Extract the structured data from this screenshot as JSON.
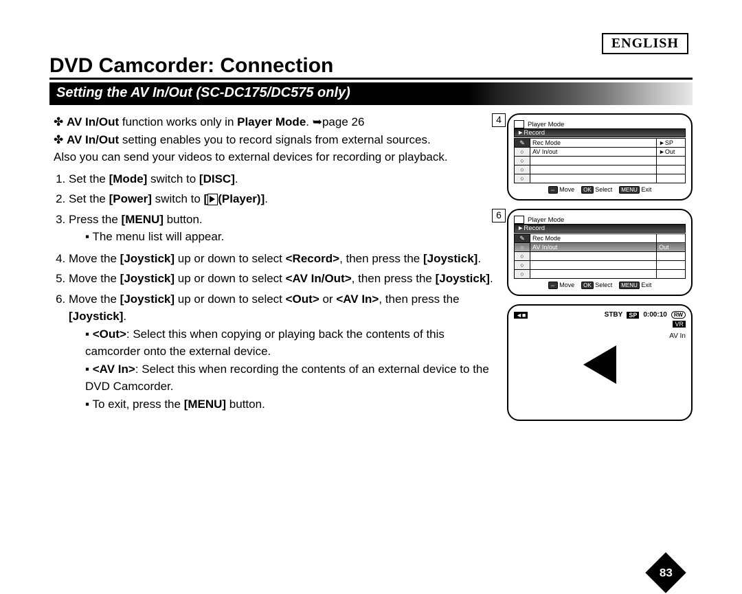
{
  "language_label": "ENGLISH",
  "title": "DVD Camcorder: Connection",
  "section_bar": "Setting the AV In/Out (SC-DC175/DC575 only)",
  "notes": [
    {
      "prefix_bold": "AV In/Out",
      "mid": " function works only in ",
      "mid_bold": "Player Mode",
      "tail": ". ➥page 26"
    },
    {
      "prefix_bold": "AV In/Out",
      "mid": " setting enables you to record signals from external sources.",
      "mid_bold": "",
      "tail": ""
    }
  ],
  "note2_extra": "Also you can send your videos to external devices for recording or playback.",
  "steps": {
    "s1a": "Set the ",
    "s1b": "[Mode]",
    "s1c": " switch to ",
    "s1d": "[DISC]",
    "s1e": ".",
    "s2a": "Set the ",
    "s2b": "[Power]",
    "s2c": " switch to ",
    "s2d": "[",
    "s2e": "(Player)]",
    "s2f": ".",
    "s3a": "Press the ",
    "s3b": "[MENU]",
    "s3c": " button.",
    "s3_sub": "The menu list will appear.",
    "s4a": "Move the ",
    "s4b": "[Joystick]",
    "s4c": " up or down to select ",
    "s4d": "<Record>",
    "s4e": ", then press the ",
    "s4f": "[Joystick]",
    "s4g": ".",
    "s5a": "Move the ",
    "s5b": "[Joystick]",
    "s5c": " up or down to select ",
    "s5d": "<AV In/Out>",
    "s5e": ", then press the ",
    "s5f": "[Joystick]",
    "s5g": ".",
    "s6a": "Move the ",
    "s6b": "[Joystick]",
    "s6c": " up or down to select ",
    "s6d": "<Out>",
    "s6e": " or ",
    "s6f": "<AV In>",
    "s6g": ", then press the ",
    "s6h": "[Joystick]",
    "s6i": ".",
    "s6_sub1a": "<Out>",
    "s6_sub1b": ": Select this when copying or playing back the contents of this camcorder onto the external device.",
    "s6_sub2a": "<AV In>",
    "s6_sub2b": ": Select this when recording the contents of an external device to the DVD Camcorder.",
    "s6_sub3a": "To exit, press the ",
    "s6_sub3b": "[MENU]",
    "s6_sub3c": " button."
  },
  "fig4": {
    "label": "4",
    "mode": "Player Mode",
    "record": "►Record",
    "row1a": "Rec Mode",
    "row1b": "►SP",
    "row2a": "AV In/out",
    "row2b": "►Out",
    "move": "Move",
    "select": "Select",
    "exit": "Exit"
  },
  "fig6": {
    "label": "6",
    "mode": "Player Mode",
    "record": "►Record",
    "row1a": "Rec Mode",
    "row1b": "",
    "row2a": "AV In/out",
    "row2b": "Out",
    "move": "Move",
    "select": "Select",
    "exit": "Exit"
  },
  "fig_stby": {
    "stby": "STBY",
    "sp": "SP",
    "time": "0:00:10",
    "rw": "RW",
    "vr": "VR",
    "avin": "AV In"
  },
  "page_number": "83"
}
